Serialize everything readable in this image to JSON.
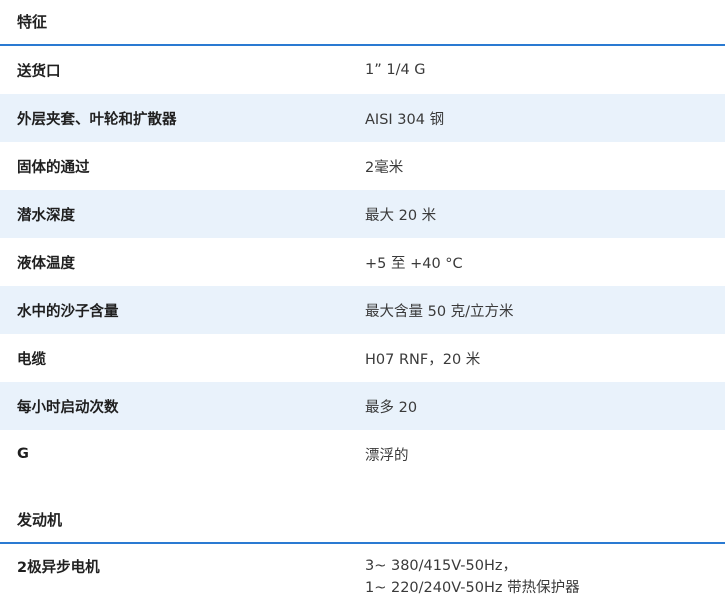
{
  "section1": {
    "title": "特征",
    "rows": [
      {
        "label": "送货口",
        "value": "1” 1/4 G"
      },
      {
        "label": "外层夹套、叶轮和扩散器",
        "value": "AISI 304 钢"
      },
      {
        "label": "固体的通过",
        "value": "2毫米"
      },
      {
        "label": "潜水深度",
        "value": "最大 20 米"
      },
      {
        "label": "液体温度",
        "value": "+5 至 +40 °C"
      },
      {
        "label": "水中的沙子含量",
        "value": "最大含量 50 克/立方米"
      },
      {
        "label": "电缆",
        "value": "H07 RNF，20 米"
      },
      {
        "label": "每小时启动次数",
        "value": "最多 20"
      },
      {
        "label": "G",
        "value": "漂浮的"
      }
    ]
  },
  "section2": {
    "title": "发动机",
    "rows": [
      {
        "label": "2极异步电机",
        "value_lines": [
          "3~ 380/415V-50Hz，",
          "1~ 220/240V-50Hz 带热保护器"
        ]
      }
    ]
  },
  "colors": {
    "accent": "#2a7ad2",
    "row_alt": "#e9f2fb"
  }
}
